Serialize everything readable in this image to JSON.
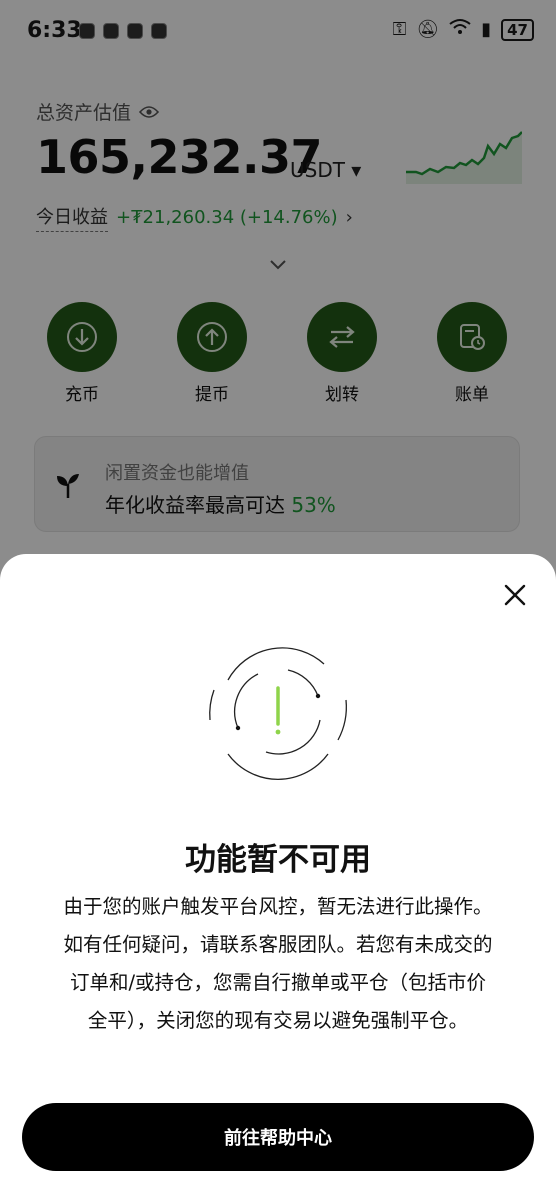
{
  "status_bar": {
    "time": "6:33",
    "battery": "47"
  },
  "assets": {
    "label": "总资产估值",
    "value": "165,232.37",
    "unit": "USDT ▾",
    "today_label": "今日收益",
    "today_value": "+₮21,260.34 (+14.76%)",
    "today_arrow": "›"
  },
  "actions": [
    {
      "label": "充币",
      "icon": "download-icon"
    },
    {
      "label": "提币",
      "icon": "upload-icon"
    },
    {
      "label": "划转",
      "icon": "transfer-icon"
    },
    {
      "label": "账单",
      "icon": "bill-icon"
    }
  ],
  "promo": {
    "line1": "闲置资金也能增值",
    "line2_prefix": "年化收益率最高可达",
    "line2_highlight": "53%"
  },
  "sheet": {
    "title": "功能暂不可用",
    "body_lines": [
      "由于您的账户触发平台风控，暂无法进行此操作。",
      "如有任何疑问，请联系客服团队。若您有未成交的",
      "订单和/或持仓，您需自行撤单或平仓（包括市价",
      "全平），关闭您的现有交易以避免强制平仓。"
    ],
    "button_label": "前往帮助中心"
  },
  "colors": {
    "accent_green": "#1f9a3a",
    "action_circle": "#245a18",
    "button_bg": "#000000"
  }
}
